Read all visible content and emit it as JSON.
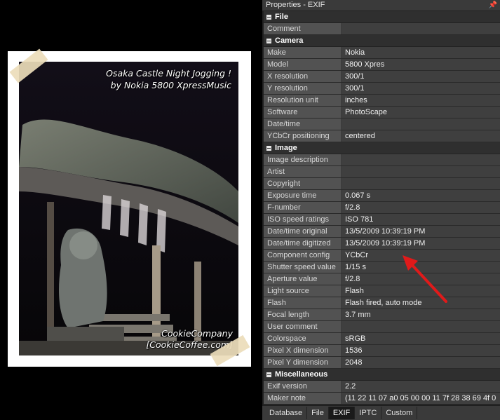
{
  "photo": {
    "caption_title": "Osaka Castle Night Jogging !",
    "caption_sub": "by Nokia 5800 XpressMusic",
    "caption_author": "CookieCompany",
    "caption_site": "[CookieCoffee.com]"
  },
  "panel": {
    "title": "Properties - EXIF",
    "pin_icon": "pin-icon",
    "categories": [
      {
        "name": "File",
        "rows": [
          {
            "k": "Comment",
            "v": ""
          }
        ]
      },
      {
        "name": "Camera",
        "rows": [
          {
            "k": "Make",
            "v": "Nokia"
          },
          {
            "k": "Model",
            "v": "5800 Xpres"
          },
          {
            "k": "X resolution",
            "v": "300/1"
          },
          {
            "k": "Y resolution",
            "v": "300/1"
          },
          {
            "k": "Resolution unit",
            "v": "inches"
          },
          {
            "k": "Software",
            "v": "PhotoScape"
          },
          {
            "k": "Date/time",
            "v": ""
          },
          {
            "k": "YCbCr positioning",
            "v": "centered"
          }
        ]
      },
      {
        "name": "Image",
        "rows": [
          {
            "k": "Image description",
            "v": ""
          },
          {
            "k": "Artist",
            "v": ""
          },
          {
            "k": "Copyright",
            "v": ""
          },
          {
            "k": "Exposure time",
            "v": "0.067 s"
          },
          {
            "k": "F-number",
            "v": "f/2.8"
          },
          {
            "k": "ISO speed ratings",
            "v": "ISO 781"
          },
          {
            "k": "Date/time original",
            "v": "13/5/2009 10:39:19 PM"
          },
          {
            "k": "Date/time digitized",
            "v": "13/5/2009 10:39:19 PM"
          },
          {
            "k": "Component config",
            "v": "YCbCr"
          },
          {
            "k": "Shutter speed value",
            "v": "1/15 s"
          },
          {
            "k": "Aperture value",
            "v": "f/2.8"
          },
          {
            "k": "Light source",
            "v": "Flash"
          },
          {
            "k": "Flash",
            "v": "Flash fired, auto mode"
          },
          {
            "k": "Focal length",
            "v": "3.7 mm"
          },
          {
            "k": "User comment",
            "v": ""
          },
          {
            "k": "Colorspace",
            "v": "sRGB"
          },
          {
            "k": "Pixel X dimension",
            "v": "1536"
          },
          {
            "k": "Pixel Y dimension",
            "v": "2048"
          }
        ]
      },
      {
        "name": "Miscellaneous",
        "rows": [
          {
            "k": "Exif version",
            "v": "2.2"
          },
          {
            "k": "Maker note",
            "v": "(11 22 11 07 a0 05 00 00 11 7f 28 38 69 4f 0"
          }
        ]
      }
    ],
    "tabs": [
      {
        "label": "Database",
        "active": false
      },
      {
        "label": "File",
        "active": false
      },
      {
        "label": "EXIF",
        "active": true
      },
      {
        "label": "IPTC",
        "active": false
      },
      {
        "label": "Custom",
        "active": false
      }
    ]
  },
  "colors": {
    "arrow": "#e01a1a",
    "panel_bg": "#202020"
  }
}
